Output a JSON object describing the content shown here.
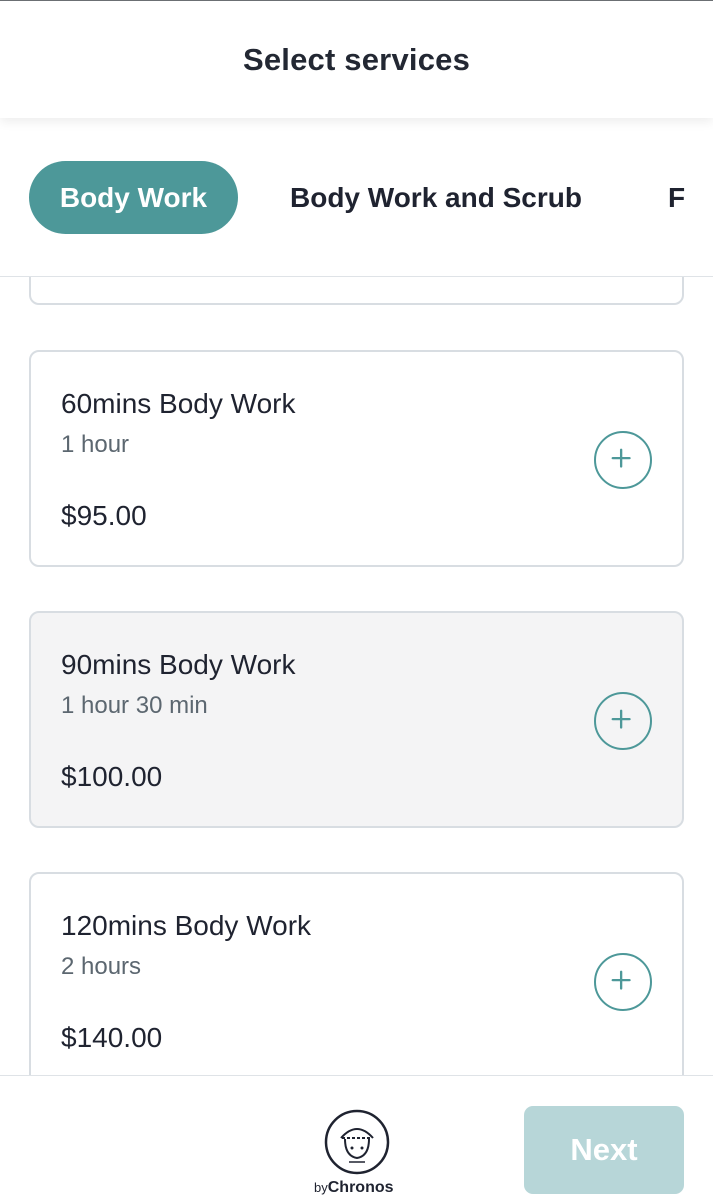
{
  "header": {
    "title": "Select services"
  },
  "tabs": [
    {
      "label": "Body Work",
      "active": true
    },
    {
      "label": "Body Work and Scrub",
      "active": false
    },
    {
      "label": "F",
      "active": false
    }
  ],
  "services": [
    {
      "name": "60mins Body Work",
      "duration": "1 hour",
      "price": "$95.00",
      "add_icon": "plus-circle-icon"
    },
    {
      "name": "90mins Body Work",
      "duration": "1 hour 30 min",
      "price": "$100.00",
      "add_icon": "plus-circle-icon",
      "highlighted": true
    },
    {
      "name": "120mins Body Work",
      "duration": "2 hours",
      "price": "$140.00",
      "add_icon": "plus-circle-icon"
    }
  ],
  "footer": {
    "brand_prefix": "by",
    "brand_name": "Chronos",
    "next_label": "Next"
  },
  "colors": {
    "accent": "#4d9899",
    "next_disabled": "#b7d6d8",
    "card_highlight": "#f4f4f5",
    "card_border": "#d8dde2"
  }
}
